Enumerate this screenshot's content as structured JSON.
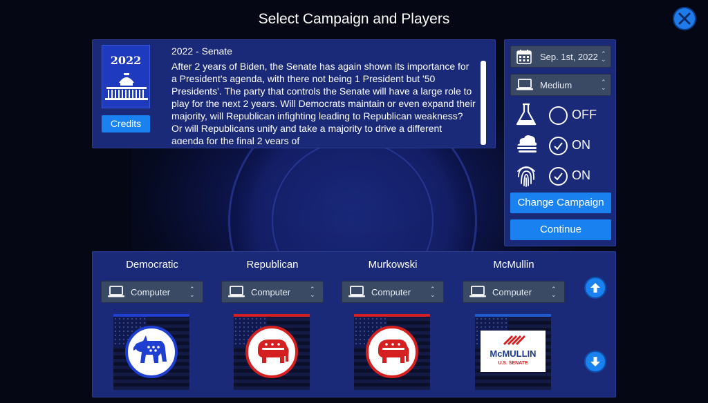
{
  "header": {
    "title": "Select Campaign and Players"
  },
  "campaign": {
    "cover_year": "2022",
    "credits_label": "Credits",
    "title": "2022 - Senate",
    "description": "After 2 years of Biden, the Senate has again shown its importance for a President's agenda, with there not being 1 President but '50 Presidents'. The party that controls the Senate will have a large role to play for the next 2 years. Will Democrats maintain or even expand their majority, will Republican infighting leading to Republican weakness? Or will Republicans unify and take a majority to drive a different agenda for the final 2 years of"
  },
  "settings": {
    "date_value": "Sep. 1st, 2022",
    "difficulty_value": "Medium",
    "toggles": [
      {
        "icon": "flask-icon",
        "state": "OFF"
      },
      {
        "icon": "cloud-icon",
        "state": "ON"
      },
      {
        "icon": "fingerprint-icon",
        "state": "ON"
      }
    ],
    "change_campaign_label": "Change Campaign",
    "continue_label": "Continue"
  },
  "players": [
    {
      "name": "Democratic",
      "control": "Computer",
      "logo": "donkey-icon",
      "accent": "#1e3fd0"
    },
    {
      "name": "Republican",
      "control": "Computer",
      "logo": "elephant-icon",
      "accent": "#d42020"
    },
    {
      "name": "Murkowski",
      "control": "Computer",
      "logo": "elephant-icon",
      "accent": "#d42020"
    },
    {
      "name": "McMullin",
      "control": "Computer",
      "logo": "mcmullin-logo",
      "accent": "#1e5ad0",
      "logo_text": {
        "line1": "McMULLIN",
        "line2": "U.S. SENATE"
      }
    }
  ],
  "colors": {
    "panel": "#1a2a78",
    "button": "#1a82f0",
    "democrat": "#1e3fd0",
    "republican": "#d42020"
  }
}
